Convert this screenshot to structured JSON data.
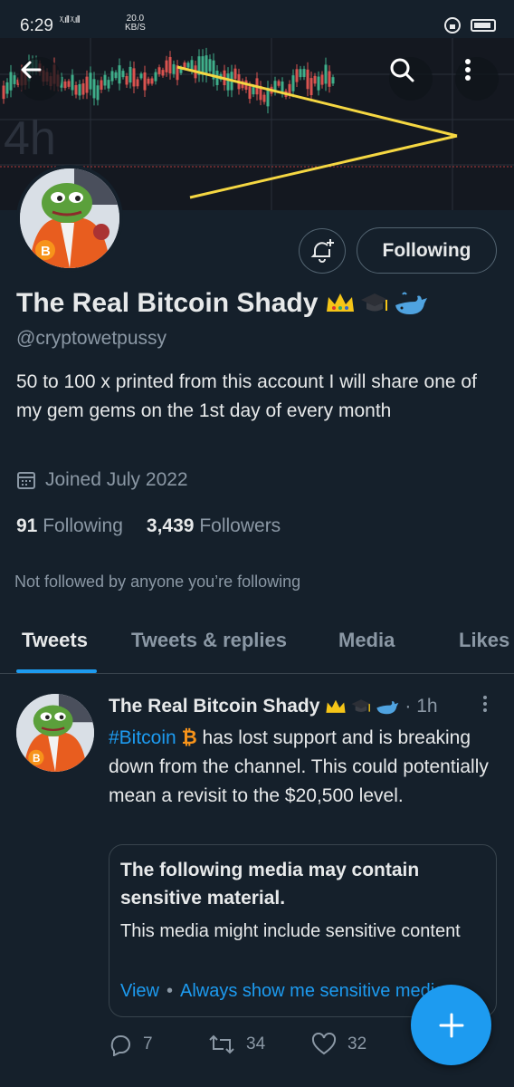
{
  "status_bar": {
    "time": "6:29",
    "signal": "ᵡ.ıll ᵡ.ıll",
    "speed_value": "20.0",
    "speed_unit": "KB/S"
  },
  "banner": {
    "chart_timeframe": "4h"
  },
  "header": {
    "back_label": "Back",
    "search_label": "Search",
    "more_label": "More"
  },
  "profile": {
    "display_name": "The Real Bitcoin Shady",
    "name_emojis": [
      "crown",
      "graduation-cap",
      "whale"
    ],
    "handle": "@cryptowetpussy",
    "bio": "50 to 100 x printed from this account I will share one of my gem gems on the 1st day of every month",
    "joined": "Joined July 2022",
    "following_count": "91",
    "following_label": "Following",
    "followers_count": "3,439",
    "followers_label": "Followers",
    "not_followed_text": "Not followed by anyone you’re following",
    "follow_button_label": "Following",
    "avatar_badge": "B"
  },
  "tabs": [
    {
      "label": "Tweets",
      "active": true
    },
    {
      "label": "Tweets & replies",
      "active": false
    },
    {
      "label": "Media",
      "active": false
    },
    {
      "label": "Likes",
      "active": false
    }
  ],
  "tweet": {
    "author_name": "The Real Bitcoin Shady",
    "time": "· 1h",
    "hashtag": "#Bitcoin",
    "bitcoin_glyph": "₿",
    "text_rest": " has lost support and is breaking down from the channel. This could potentially mean a revisit to the $20,500 level.",
    "sensitive_title": "The following media may contain sensitive material.",
    "sensitive_body": "This media might include sensitive content",
    "view_label": "View",
    "separator": "•",
    "always_show_label": "Always show me sensitive media",
    "replies": "7",
    "retweets": "34",
    "likes": "32"
  },
  "colors": {
    "accent": "#1d9bf0",
    "background": "#15202b",
    "muted": "#8b98a5",
    "bitcoin": "#f7931a",
    "chart_line": "#f5d742"
  }
}
